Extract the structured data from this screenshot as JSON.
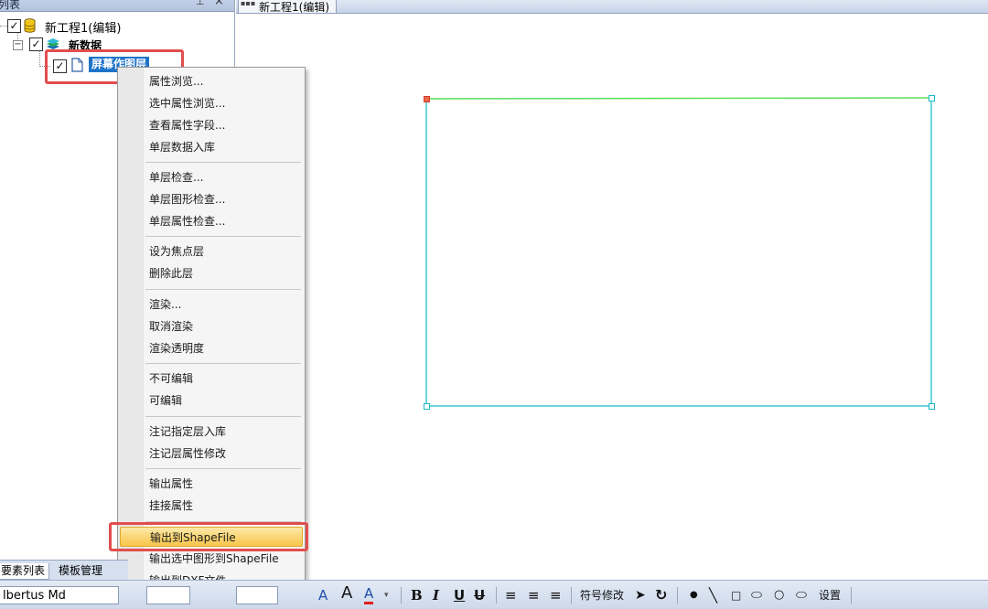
{
  "left_panel": {
    "title": "列表",
    "pin_icon": "⊥",
    "close_icon": "×",
    "tree": {
      "project_label": "新工程1(编辑)",
      "dataset_label": "新数据",
      "layer_label": "屏幕作图层"
    }
  },
  "document": {
    "tab_title": "新工程1(编辑)"
  },
  "context_menu": {
    "items": [
      "属性浏览...",
      "选中属性浏览...",
      "查看属性字段...",
      "单层数据入库",
      "单层检查...",
      "单层图形检查...",
      "单层属性检查...",
      "设为焦点层",
      "删除此层",
      "渲染...",
      "取消渲染",
      "渲染透明度",
      "不可编辑",
      "可编辑",
      "注记指定层入库",
      "注记层属性修改",
      "输出属性",
      "挂接属性",
      "输出到ShapeFile",
      "输出选中图形到ShapeFile",
      "输出到DXF文件"
    ],
    "highlighted_item": "输出到ShapeFile"
  },
  "bottom_tabs": {
    "features": "要素列表",
    "templates": "模板管理"
  },
  "toolbar": {
    "font_name": "lbertus Md",
    "font_grow": "A",
    "font_shrink": "A",
    "font_color": "A",
    "bold": "B",
    "italic": "I",
    "underline": "U",
    "strike": "U",
    "symbol_edit": "符号修改",
    "settings": "设置"
  },
  "colors": {
    "accent_selection": "#1e73c9",
    "highlight_red": "#e24d4d",
    "shape_outline": "#3cc8d6",
    "menu_hover": "#f7c54a"
  }
}
